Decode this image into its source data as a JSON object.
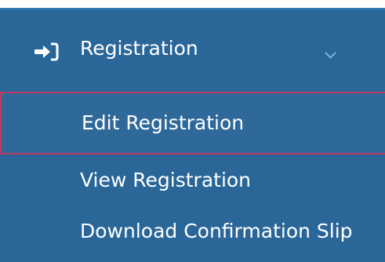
{
  "menu": {
    "header": {
      "label": "Registration",
      "icon": "sign-in-icon",
      "expanded_icon": "chevron-down-icon"
    },
    "items": [
      {
        "label": "Edit Registration",
        "active": true
      },
      {
        "label": "View Registration",
        "active": false
      },
      {
        "label": "Download Confirmation Slip",
        "active": false
      }
    ]
  },
  "colors": {
    "panel": "#2a6798",
    "text": "#ffffff",
    "active_border": "#be3a63",
    "chevron": "#7fb1d8"
  }
}
